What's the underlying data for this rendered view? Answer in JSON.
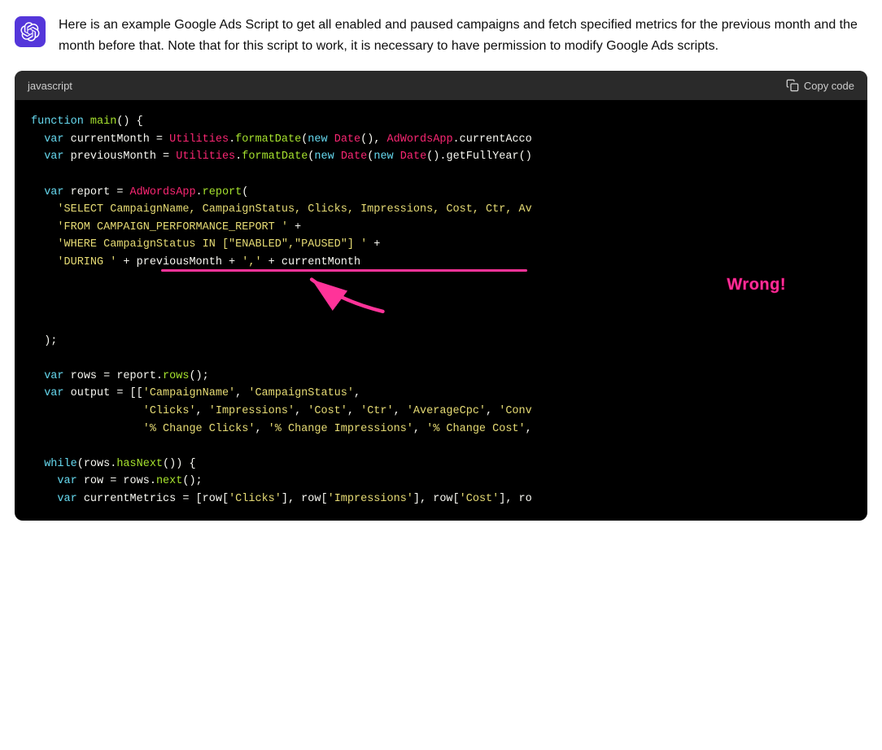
{
  "header": {
    "intro": "Here is an example Google Ads Script to get all enabled and paused campaigns and fetch specified metrics for the previous month and the month before that. Note that for this script to work, it is necessary to have permission to modify Google Ads scripts."
  },
  "code_block": {
    "language": "javascript",
    "copy_button_label": "Copy code",
    "wrong_annotation": "Wrong!"
  }
}
